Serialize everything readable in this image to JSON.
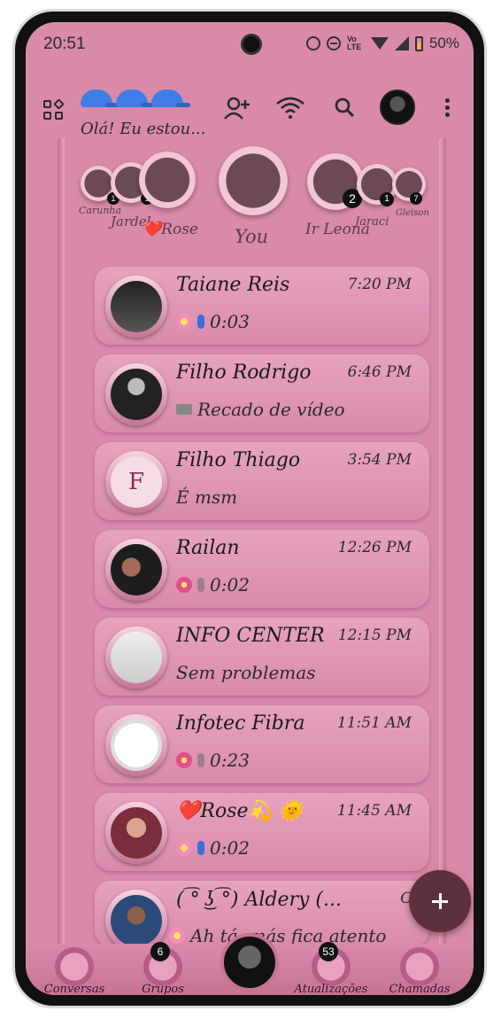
{
  "status_bar": {
    "time": "20:51",
    "volte": "Vo LTE",
    "battery": "50%"
  },
  "top_bar": {
    "title": "Olá! Eu estou..."
  },
  "stories": [
    {
      "name": "Carunha",
      "badge": "1"
    },
    {
      "name": "Jardel",
      "badge": "1"
    },
    {
      "name": "❤️Rose",
      "badge": ""
    },
    {
      "name": "You",
      "badge": ""
    },
    {
      "name": "Ir Leona",
      "badge": "2"
    },
    {
      "name": "Jaraci",
      "badge": "1"
    },
    {
      "name": "Gleison",
      "badge": "7"
    }
  ],
  "chats": [
    {
      "name": "Taiane Reis",
      "time": "7:20 PM",
      "preview": "0:03",
      "type": "voice",
      "mic_color": "#3d6fd6"
    },
    {
      "name": "Filho Rodrigo",
      "time": "6:46 PM",
      "preview": "Recado de vídeo",
      "type": "video"
    },
    {
      "name": "Filho Thiago",
      "time": "3:54 PM",
      "preview": "É msm",
      "type": "text",
      "avatar_letter": "F"
    },
    {
      "name": "Railan",
      "time": "12:26 PM",
      "preview": "0:02",
      "type": "voice",
      "mic_color": "#9a7e8a"
    },
    {
      "name": "INFO CENTER",
      "time": "12:15 PM",
      "preview": "Sem problemas",
      "type": "text"
    },
    {
      "name": "Infotec Fibra",
      "time": "11:51 AM",
      "preview": "0:23",
      "type": "voice",
      "mic_color": "#9a7e8a"
    },
    {
      "name": "❤️Rose💫 🌞",
      "time": "11:45 AM",
      "preview": "0:02",
      "type": "voice",
      "mic_color": "#3d6fd6"
    },
    {
      "name": "( ͡° ͜ʖ ͡°) Aldery (...",
      "time": "Onten",
      "preview": "Ah tá, más fica atento",
      "type": "text"
    }
  ],
  "bottom_nav": {
    "items": [
      {
        "label": "Conversas",
        "badge": ""
      },
      {
        "label": "Grupos",
        "badge": "6"
      },
      {
        "label": "Atualizações",
        "badge": "53"
      },
      {
        "label": "Chamadas",
        "badge": ""
      }
    ]
  },
  "colors": {
    "background": "#d98aaa",
    "fab": "#5e2f3c",
    "accent_blue": "#3f7ee6"
  }
}
